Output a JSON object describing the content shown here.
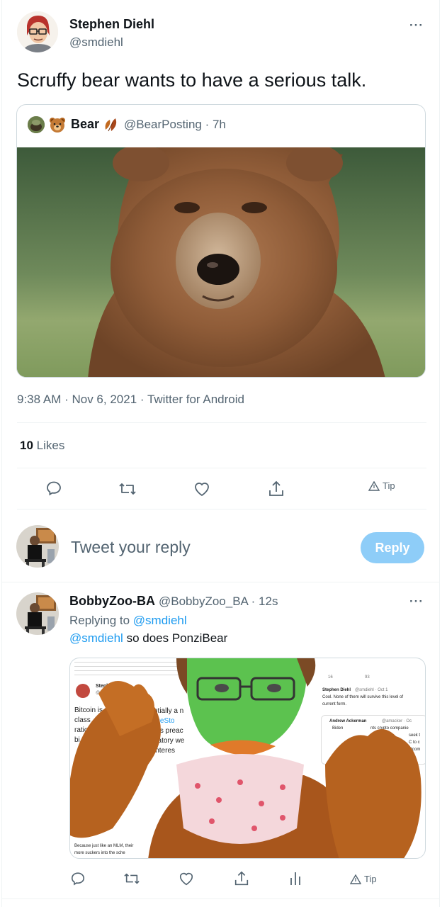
{
  "main_tweet": {
    "author_name": "Stephen Diehl",
    "author_handle": "@smdiehl",
    "text": "Scruffy bear wants to have a serious talk.",
    "timestamp": "9:38 AM · Nov 6, 2021 · Twitter for Android",
    "likes_count": "10",
    "likes_label": "Likes",
    "tip_label": "Tip"
  },
  "quoted_tweet": {
    "author_name": "Bear",
    "author_handle_time": "@BearPosting · 7h"
  },
  "reply_composer": {
    "placeholder": "Tweet your reply",
    "button_label": "Reply",
    "button_color": "#8ecdf8"
  },
  "reply_tweet": {
    "author_name": "BobbyZoo-BA",
    "author_handle_time": "@BobbyZoo_BA · 12s",
    "replying_to_prefix": "Replying to",
    "replying_to_handle": "@smdiehl",
    "mention": "@smdiehl",
    "text": "so does PonziBear",
    "tip_label": "Tip"
  },
  "reply_image_text": {
    "left_name": "Stephen Diehl",
    "left_handle": "@smdiehl",
    "left_line1": "Bitcoin is",
    "left_line1b": "ntially a n",
    "left_line2": "class",
    "left_line2b": "rgeSto",
    "left_line3": "ratio",
    "left_line3b": "ers preac",
    "left_line4": "bi",
    "left_line4b": "datory we",
    "left_line5": "interes",
    "left_bottom1": "Because just like an MLM, their",
    "left_bottom2": "more suckers into the sche",
    "right_name": "Stephen Diehl",
    "right_handle_time": "@smdiehl · Oct 1",
    "right_line1": "Cool. None of them will survive this level of",
    "right_line2": "current form.",
    "right_quote_name": "Andrew Ackerman",
    "right_quote_handle": "@amacker · Oc",
    "right_q1": "Biden",
    "right_q1b": "nts crypto companie",
    "right_q2": "seek t",
    "right_q3": "C to c",
    "right_q4": "utcom",
    "stat_retweets": "16",
    "stat_likes": "93"
  },
  "colors": {
    "accent": "#1d9bf0",
    "muted": "#536471",
    "divider": "#eff3f4"
  }
}
